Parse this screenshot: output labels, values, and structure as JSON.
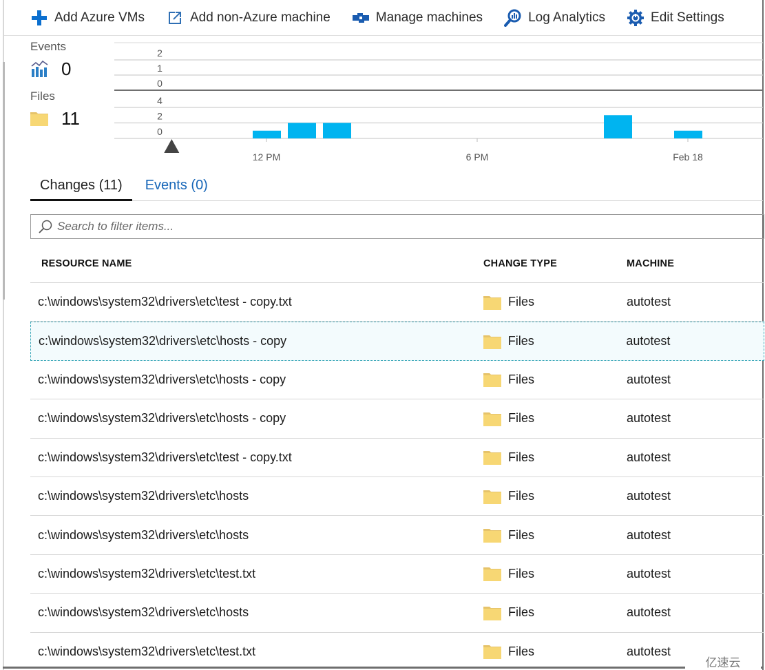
{
  "toolbar": {
    "buttons": [
      {
        "label": "Add Azure VMs",
        "icon": "plus-icon"
      },
      {
        "label": "Add non-Azure machine",
        "icon": "external-link-icon"
      },
      {
        "label": "Manage machines",
        "icon": "machines-icon"
      },
      {
        "label": "Log Analytics",
        "icon": "log-analytics-icon"
      },
      {
        "label": "Edit Settings",
        "icon": "gear-icon"
      }
    ]
  },
  "summary": {
    "events": {
      "label": "Events",
      "value": "0",
      "icon": "events-chart-icon"
    },
    "files": {
      "label": "Files",
      "value": "11",
      "icon": "folder-icon"
    }
  },
  "colors": {
    "accent": "#0078d4",
    "bar": "#00b4f0",
    "folder": "#f7d774",
    "link": "#1666b8",
    "selected_border": "#3aa7b8"
  },
  "chart_data": [
    {
      "type": "bar",
      "title": "Events",
      "y_ticks": [
        "2",
        "1",
        "0"
      ],
      "ylim": [
        0,
        2
      ],
      "categories": [
        "12 PM",
        "6 PM",
        "Feb 18"
      ],
      "values": [],
      "grid": true
    },
    {
      "type": "bar",
      "title": "Files",
      "y_ticks": [
        "4",
        "2",
        "0"
      ],
      "ylim": [
        0,
        4
      ],
      "x_tick_labels": [
        "12 PM",
        "6 PM",
        "Feb 18"
      ],
      "x_hours": [
        12,
        18,
        24
      ],
      "x_range_hours": [
        7.7,
        26
      ],
      "bars": [
        {
          "hour": 12,
          "value": 1
        },
        {
          "hour": 13,
          "value": 2
        },
        {
          "hour": 14,
          "value": 2
        },
        {
          "hour": 22,
          "value": 3
        },
        {
          "hour": 24,
          "value": 1
        }
      ],
      "marker_hour": 9.3,
      "grid": true
    }
  ],
  "tabs": [
    {
      "label": "Changes (11)",
      "active": true
    },
    {
      "label": "Events (0)",
      "active": false
    }
  ],
  "search": {
    "placeholder": "Search to filter items..."
  },
  "table": {
    "headers": [
      "RESOURCE NAME",
      "CHANGE TYPE",
      "MACHINE"
    ],
    "rows": [
      {
        "name": "c:\\windows\\system32\\drivers\\etc\\test - copy.txt",
        "type": "Files",
        "machine": "autotest",
        "selected": false
      },
      {
        "name": "c:\\windows\\system32\\drivers\\etc\\hosts - copy",
        "type": "Files",
        "machine": "autotest",
        "selected": true
      },
      {
        "name": "c:\\windows\\system32\\drivers\\etc\\hosts - copy",
        "type": "Files",
        "machine": "autotest",
        "selected": false
      },
      {
        "name": "c:\\windows\\system32\\drivers\\etc\\hosts - copy",
        "type": "Files",
        "machine": "autotest",
        "selected": false
      },
      {
        "name": "c:\\windows\\system32\\drivers\\etc\\test - copy.txt",
        "type": "Files",
        "machine": "autotest",
        "selected": false
      },
      {
        "name": "c:\\windows\\system32\\drivers\\etc\\hosts",
        "type": "Files",
        "machine": "autotest",
        "selected": false
      },
      {
        "name": "c:\\windows\\system32\\drivers\\etc\\hosts",
        "type": "Files",
        "machine": "autotest",
        "selected": false
      },
      {
        "name": "c:\\windows\\system32\\drivers\\etc\\test.txt",
        "type": "Files",
        "machine": "autotest",
        "selected": false
      },
      {
        "name": "c:\\windows\\system32\\drivers\\etc\\hosts",
        "type": "Files",
        "machine": "autotest",
        "selected": false
      },
      {
        "name": "c:\\windows\\system32\\drivers\\etc\\test.txt",
        "type": "Files",
        "machine": "autotest",
        "selected": false
      }
    ]
  },
  "watermark": "亿速云"
}
